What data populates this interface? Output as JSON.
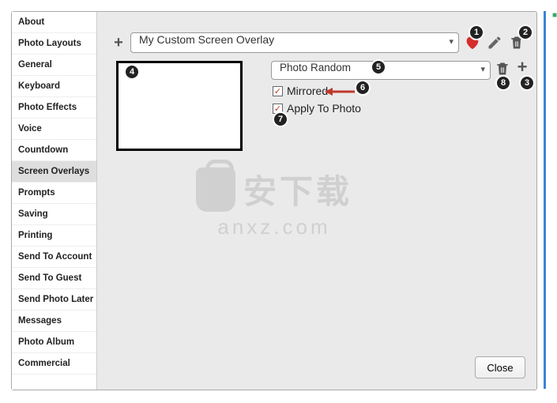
{
  "sidebar": {
    "items": [
      {
        "label": "About"
      },
      {
        "label": "Photo Layouts"
      },
      {
        "label": "General"
      },
      {
        "label": "Keyboard"
      },
      {
        "label": "Photo Effects"
      },
      {
        "label": "Voice"
      },
      {
        "label": "Countdown"
      },
      {
        "label": "Screen Overlays"
      },
      {
        "label": "Prompts"
      },
      {
        "label": "Saving"
      },
      {
        "label": "Printing"
      },
      {
        "label": "Send To Account"
      },
      {
        "label": "Send To Guest"
      },
      {
        "label": "Send Photo Later"
      },
      {
        "label": "Messages"
      },
      {
        "label": "Photo Album"
      },
      {
        "label": "Commercial"
      }
    ],
    "selected_index": 7
  },
  "overlay": {
    "name": "My Custom Screen Overlay",
    "source": "Photo Random",
    "mirrored": true,
    "mirrored_label": "Mirrored",
    "apply_to_photo": true,
    "apply_label": "Apply To Photo"
  },
  "buttons": {
    "close": "Close"
  },
  "callouts": {
    "c1": "1",
    "c2": "2",
    "c3": "3",
    "c4": "4",
    "c5": "5",
    "c6": "6",
    "c7": "7",
    "c8": "8"
  },
  "watermark": {
    "line1": "安下载",
    "line2": "anxz.com"
  }
}
